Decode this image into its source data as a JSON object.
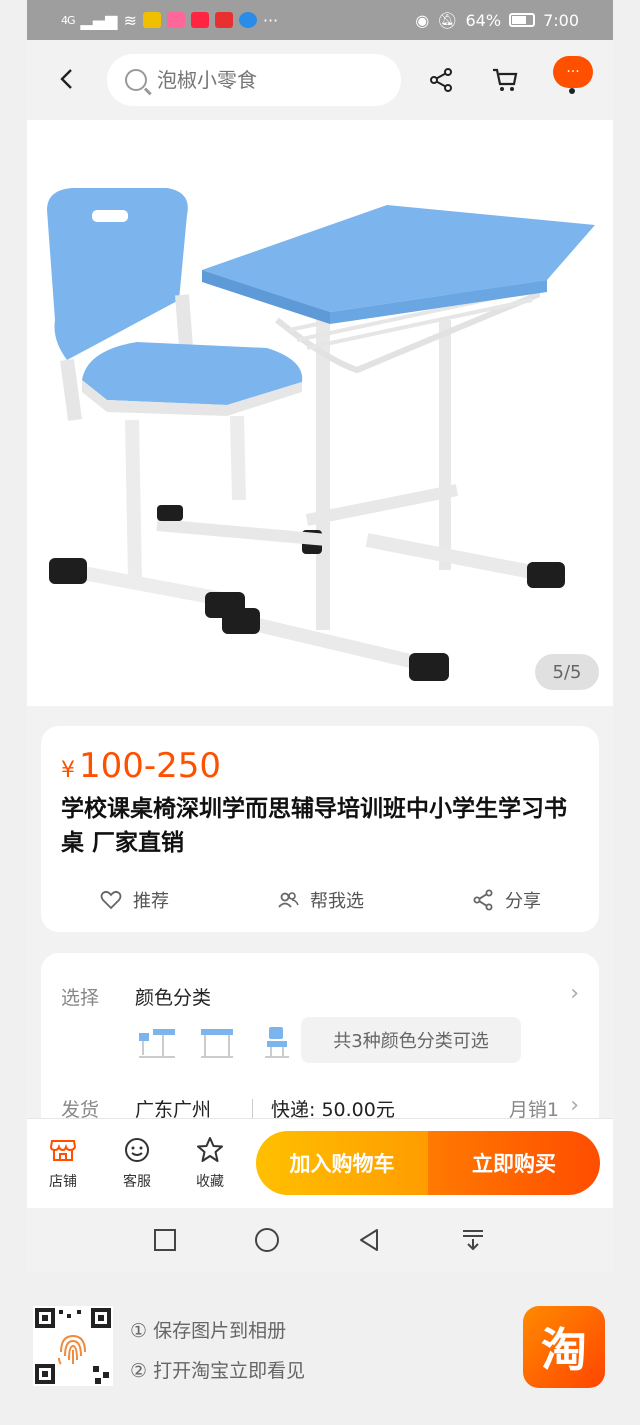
{
  "status_bar": {
    "network": "4G",
    "battery": "64%",
    "time": "7:00",
    "app_icons": [
      "weibo-icon",
      "bilibili-icon",
      "xiaohongshu-icon",
      "red-app-icon",
      "browser-icon"
    ],
    "more": "···"
  },
  "topnav": {
    "search_placeholder": "泡椒小零食",
    "more_label": "···"
  },
  "gallery": {
    "counter": "5/5"
  },
  "product": {
    "currency": "¥",
    "price": "100-250",
    "title": "学校课桌椅深圳学而思辅导培训班中小学生学习书桌 厂家直销",
    "actions": [
      {
        "label": "推荐",
        "icon": "heart-icon"
      },
      {
        "label": "帮我选",
        "icon": "people-icon"
      },
      {
        "label": "分享",
        "icon": "share-icon"
      }
    ]
  },
  "spec": {
    "select_label": "选择",
    "select_value": "颜色分类",
    "options_chip": "共3种颜色分类可选",
    "ship_label": "发货",
    "ship_origin": "广东广州",
    "ship_fee": "快递: 50.00元",
    "monthly_sales": "月销1"
  },
  "bottom_bar": {
    "shop": "店铺",
    "service": "客服",
    "favorite": "收藏",
    "add_to_cart": "加入购物车",
    "buy_now": "立即购买"
  },
  "footer": {
    "tip1": "① 保存图片到相册",
    "tip2": "② 打开淘宝立即看见",
    "logo": "淘"
  },
  "colors": {
    "accent": "#ff5000",
    "cart_gradient": [
      "#ffc000",
      "#ff9c00"
    ],
    "buy_gradient": [
      "#ff7a00",
      "#ff4d00"
    ],
    "furniture_blue": "#7ab6ec"
  }
}
